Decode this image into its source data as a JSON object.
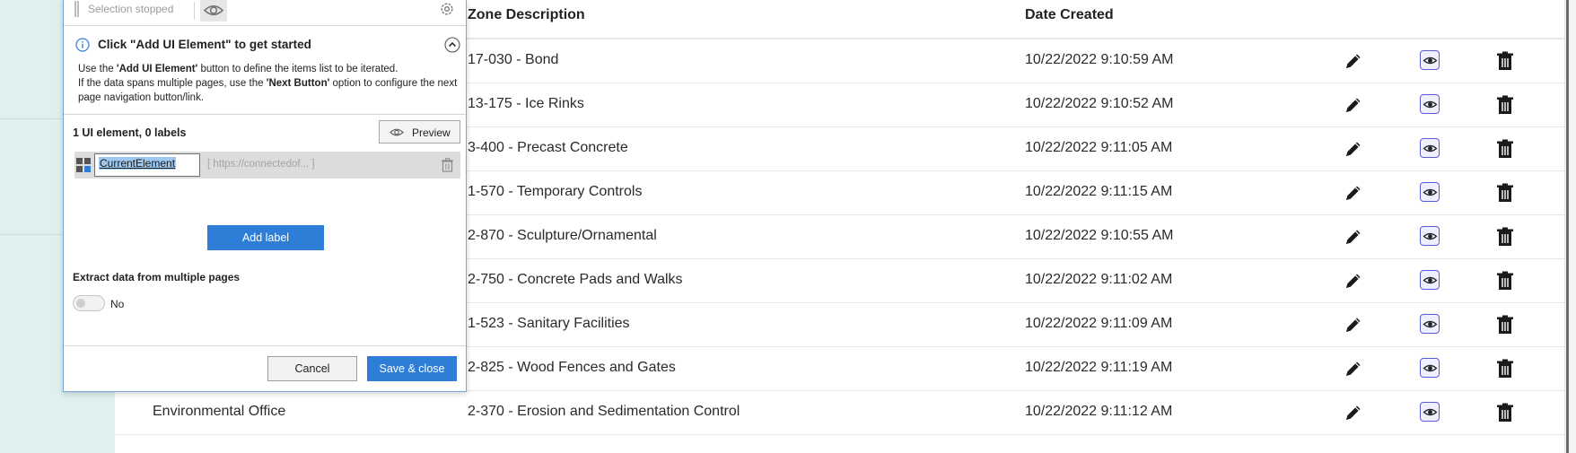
{
  "dialog": {
    "selection_status": "Selection stopped",
    "info_title": "Click \"Add UI Element\" to get started",
    "info_line1_pre": "Use the ",
    "info_line1_bold": "'Add UI Element'",
    "info_line1_post": " button to define the items list to be iterated.",
    "info_line2_pre": "If the data spans multiple pages, use the ",
    "info_line2_bold": "'Next Button'",
    "info_line2_post": " option to configure the next page navigation button/link.",
    "element_count": "1 UI element, 0 labels",
    "preview_label": "Preview",
    "element_name": "CurrentElement",
    "element_selector": "[ https://connectedof... ]",
    "add_label": "Add label",
    "extract_label": "Extract data from multiple pages",
    "toggle_text": "No",
    "cancel_label": "Cancel",
    "save_label": "Save & close"
  },
  "table": {
    "headers": {
      "zone_description": "Zone Description",
      "date_created": "Date Created"
    },
    "rows": [
      {
        "office": "",
        "zone": "17-030 - Bond",
        "date": "10/22/2022 9:10:59 AM"
      },
      {
        "office": "",
        "zone": "13-175 - Ice Rinks",
        "date": "10/22/2022 9:10:52 AM"
      },
      {
        "office": "",
        "zone": "3-400 - Precast Concrete",
        "date": "10/22/2022 9:11:05 AM"
      },
      {
        "office": "",
        "zone": "1-570 - Temporary Controls",
        "date": "10/22/2022 9:11:15 AM"
      },
      {
        "office": "",
        "zone": "2-870 - Sculpture/Ornamental",
        "date": "10/22/2022 9:10:55 AM"
      },
      {
        "office": "",
        "zone": "2-750 - Concrete Pads and Walks",
        "date": "10/22/2022 9:11:02 AM"
      },
      {
        "office": "",
        "zone": "1-523 - Sanitary Facilities",
        "date": "10/22/2022 9:11:09 AM"
      },
      {
        "office": "",
        "zone": "2-825 - Wood Fences and Gates",
        "date": "10/22/2022 9:11:19 AM"
      },
      {
        "office": "Environmental Office",
        "zone": "2-370 - Erosion and Sedimentation Control",
        "date": "10/22/2022 9:11:12 AM"
      }
    ]
  },
  "colors": {
    "accent": "#2e7dd7",
    "eye_border": "#5b5bd6",
    "sidebar_bg": "#dff0ef"
  },
  "icons": [
    "pencil-icon",
    "eye-icon",
    "trash-icon",
    "gear-icon",
    "info-icon",
    "chevron-up-icon",
    "grid-icon"
  ]
}
